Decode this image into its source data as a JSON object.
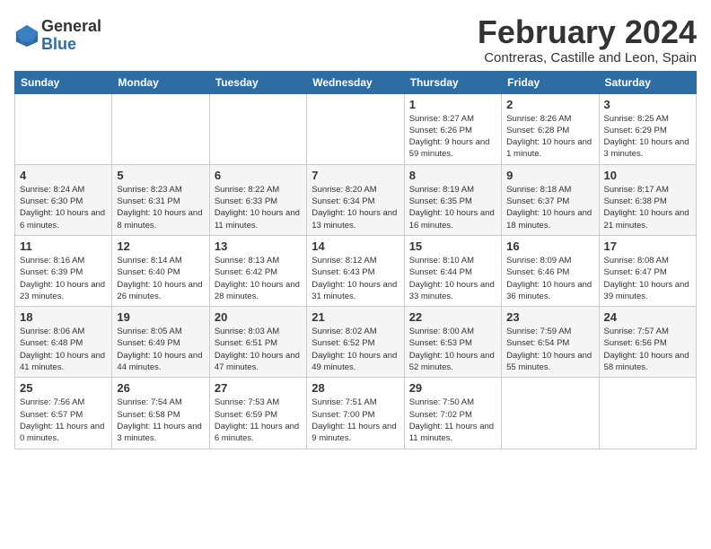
{
  "header": {
    "logo_general": "General",
    "logo_blue": "Blue",
    "month_title": "February 2024",
    "location": "Contreras, Castille and Leon, Spain"
  },
  "weekdays": [
    "Sunday",
    "Monday",
    "Tuesday",
    "Wednesday",
    "Thursday",
    "Friday",
    "Saturday"
  ],
  "weeks": [
    [
      {
        "day": "",
        "info": ""
      },
      {
        "day": "",
        "info": ""
      },
      {
        "day": "",
        "info": ""
      },
      {
        "day": "",
        "info": ""
      },
      {
        "day": "1",
        "info": "Sunrise: 8:27 AM\nSunset: 6:26 PM\nDaylight: 9 hours\nand 59 minutes."
      },
      {
        "day": "2",
        "info": "Sunrise: 8:26 AM\nSunset: 6:28 PM\nDaylight: 10 hours\nand 1 minute."
      },
      {
        "day": "3",
        "info": "Sunrise: 8:25 AM\nSunset: 6:29 PM\nDaylight: 10 hours\nand 3 minutes."
      }
    ],
    [
      {
        "day": "4",
        "info": "Sunrise: 8:24 AM\nSunset: 6:30 PM\nDaylight: 10 hours\nand 6 minutes."
      },
      {
        "day": "5",
        "info": "Sunrise: 8:23 AM\nSunset: 6:31 PM\nDaylight: 10 hours\nand 8 minutes."
      },
      {
        "day": "6",
        "info": "Sunrise: 8:22 AM\nSunset: 6:33 PM\nDaylight: 10 hours\nand 11 minutes."
      },
      {
        "day": "7",
        "info": "Sunrise: 8:20 AM\nSunset: 6:34 PM\nDaylight: 10 hours\nand 13 minutes."
      },
      {
        "day": "8",
        "info": "Sunrise: 8:19 AM\nSunset: 6:35 PM\nDaylight: 10 hours\nand 16 minutes."
      },
      {
        "day": "9",
        "info": "Sunrise: 8:18 AM\nSunset: 6:37 PM\nDaylight: 10 hours\nand 18 minutes."
      },
      {
        "day": "10",
        "info": "Sunrise: 8:17 AM\nSunset: 6:38 PM\nDaylight: 10 hours\nand 21 minutes."
      }
    ],
    [
      {
        "day": "11",
        "info": "Sunrise: 8:16 AM\nSunset: 6:39 PM\nDaylight: 10 hours\nand 23 minutes."
      },
      {
        "day": "12",
        "info": "Sunrise: 8:14 AM\nSunset: 6:40 PM\nDaylight: 10 hours\nand 26 minutes."
      },
      {
        "day": "13",
        "info": "Sunrise: 8:13 AM\nSunset: 6:42 PM\nDaylight: 10 hours\nand 28 minutes."
      },
      {
        "day": "14",
        "info": "Sunrise: 8:12 AM\nSunset: 6:43 PM\nDaylight: 10 hours\nand 31 minutes."
      },
      {
        "day": "15",
        "info": "Sunrise: 8:10 AM\nSunset: 6:44 PM\nDaylight: 10 hours\nand 33 minutes."
      },
      {
        "day": "16",
        "info": "Sunrise: 8:09 AM\nSunset: 6:46 PM\nDaylight: 10 hours\nand 36 minutes."
      },
      {
        "day": "17",
        "info": "Sunrise: 8:08 AM\nSunset: 6:47 PM\nDaylight: 10 hours\nand 39 minutes."
      }
    ],
    [
      {
        "day": "18",
        "info": "Sunrise: 8:06 AM\nSunset: 6:48 PM\nDaylight: 10 hours\nand 41 minutes."
      },
      {
        "day": "19",
        "info": "Sunrise: 8:05 AM\nSunset: 6:49 PM\nDaylight: 10 hours\nand 44 minutes."
      },
      {
        "day": "20",
        "info": "Sunrise: 8:03 AM\nSunset: 6:51 PM\nDaylight: 10 hours\nand 47 minutes."
      },
      {
        "day": "21",
        "info": "Sunrise: 8:02 AM\nSunset: 6:52 PM\nDaylight: 10 hours\nand 49 minutes."
      },
      {
        "day": "22",
        "info": "Sunrise: 8:00 AM\nSunset: 6:53 PM\nDaylight: 10 hours\nand 52 minutes."
      },
      {
        "day": "23",
        "info": "Sunrise: 7:59 AM\nSunset: 6:54 PM\nDaylight: 10 hours\nand 55 minutes."
      },
      {
        "day": "24",
        "info": "Sunrise: 7:57 AM\nSunset: 6:56 PM\nDaylight: 10 hours\nand 58 minutes."
      }
    ],
    [
      {
        "day": "25",
        "info": "Sunrise: 7:56 AM\nSunset: 6:57 PM\nDaylight: 11 hours\nand 0 minutes."
      },
      {
        "day": "26",
        "info": "Sunrise: 7:54 AM\nSunset: 6:58 PM\nDaylight: 11 hours\nand 3 minutes."
      },
      {
        "day": "27",
        "info": "Sunrise: 7:53 AM\nSunset: 6:59 PM\nDaylight: 11 hours\nand 6 minutes."
      },
      {
        "day": "28",
        "info": "Sunrise: 7:51 AM\nSunset: 7:00 PM\nDaylight: 11 hours\nand 9 minutes."
      },
      {
        "day": "29",
        "info": "Sunrise: 7:50 AM\nSunset: 7:02 PM\nDaylight: 11 hours\nand 11 minutes."
      },
      {
        "day": "",
        "info": ""
      },
      {
        "day": "",
        "info": ""
      }
    ]
  ]
}
